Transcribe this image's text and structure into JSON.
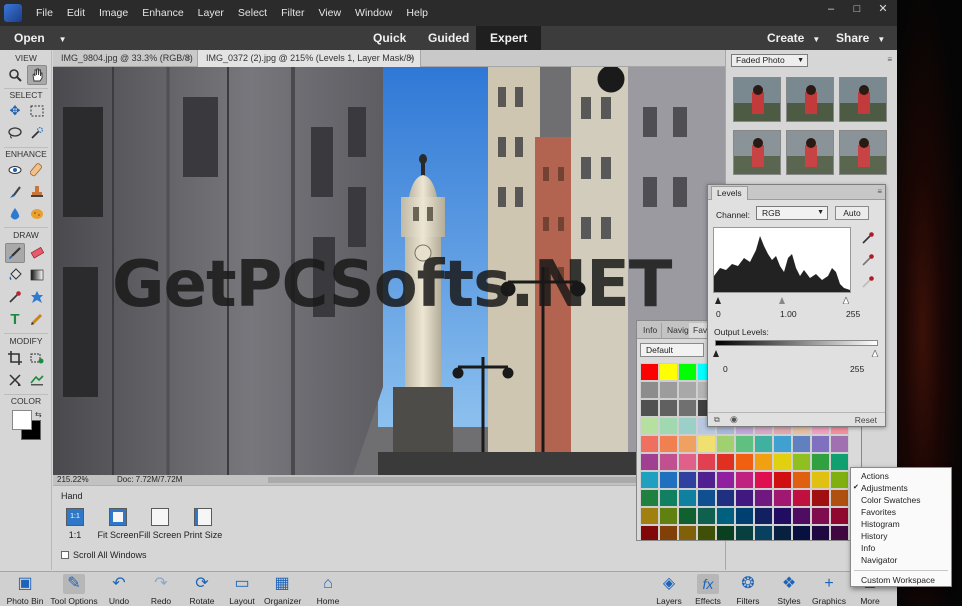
{
  "menubar": {
    "items": [
      "File",
      "Edit",
      "Image",
      "Enhance",
      "Layer",
      "Select",
      "Filter",
      "View",
      "Window",
      "Help"
    ],
    "window_controls": [
      "–",
      "□",
      "✕"
    ]
  },
  "modebar": {
    "open_label": "Open",
    "modes": [
      "Quick",
      "Guided",
      "Expert"
    ],
    "active_mode": "Expert",
    "create_label": "Create",
    "share_label": "Share"
  },
  "toolbox": {
    "sections": [
      "VIEW",
      "SELECT",
      "ENHANCE",
      "DRAW",
      "MODIFY",
      "COLOR"
    ]
  },
  "tabs": [
    {
      "label": "IMG_9804.jpg @ 33.3% (RGB/8)",
      "close": "×"
    },
    {
      "label": "IMG_0372 (2).jpg @ 215% (Levels 1, Layer Mask/8) *",
      "close": "×"
    }
  ],
  "watermark": "GetPCSofts.NET",
  "status": {
    "zoom": "215.22%",
    "doc_size": "Doc: 7.72M/7.72M"
  },
  "tool_options": {
    "tool_name": "Hand",
    "buttons": [
      {
        "icon_text": "1:1",
        "label": "1:1"
      },
      {
        "label": "Fit Screen"
      },
      {
        "label": "Fill Screen"
      },
      {
        "label": "Print Size"
      }
    ],
    "scroll_all_label": "Scroll All Windows"
  },
  "right_panel": {
    "effect_select": "Faded Photo"
  },
  "levels": {
    "tab_label": "Levels",
    "channel_label": "Channel:",
    "channel_value": "RGB",
    "auto_label": "Auto",
    "input_values": [
      "0",
      "1.00",
      "255"
    ],
    "output_label": "Output Levels:",
    "output_values": [
      "0",
      "255"
    ],
    "reset_label": "Reset"
  },
  "swatches": {
    "tabs": [
      "Info",
      "Navig",
      "Favo"
    ],
    "set_value": "Default",
    "colors": [
      "#ff0000",
      "#ffff00",
      "#00ff00",
      "#00ffff",
      "#8e8e8e",
      "#8e8e8e",
      "#8e8e8e",
      "#8e8e8e",
      "#8e8e8e",
      "#8e8e8e",
      "#8e8e8e",
      "#8c8c8c",
      "#9c9c9c",
      "#a8a8a8",
      "#b4b4b4",
      "#8a8a8a",
      "#7a7a7a",
      "#6a6a6a",
      "#5a5a5a",
      "#4a4a4a",
      "#3a3a3a",
      "#2a2a2a",
      "#505050",
      "#606060",
      "#707070",
      "#404040",
      "#353535",
      "#2d2d2d",
      "#252525",
      "#1d1d1d",
      "#151515",
      "#101010",
      "#080808",
      "#b5e0a0",
      "#a0d8b0",
      "#9ad0c8",
      "#b8c8e0",
      "#a8b8d8",
      "#c0a8d8",
      "#d8a8c8",
      "#e0a8b0",
      "#e8c0a0",
      "#f0a0c0",
      "#f090a0",
      "#f07060",
      "#f08050",
      "#f0a060",
      "#f0e070",
      "#a0d070",
      "#60c080",
      "#40b0a0",
      "#40a0d0",
      "#6080c0",
      "#8070c0",
      "#a070b0",
      "#a04090",
      "#c05090",
      "#e0608a",
      "#e04050",
      "#e03020",
      "#f06010",
      "#f0a010",
      "#e0d010",
      "#90c020",
      "#30a040",
      "#10a070",
      "#20a0c0",
      "#2070c0",
      "#3040a0",
      "#502090",
      "#9020a0",
      "#c02080",
      "#e01050",
      "#d01010",
      "#e06010",
      "#e0c010",
      "#80b010",
      "#208040",
      "#108060",
      "#1080a0",
      "#105090",
      "#203080",
      "#401880",
      "#701880",
      "#a01870",
      "#c01040",
      "#a01010",
      "#b05010",
      "#a08010",
      "#608010",
      "#106030",
      "#106050",
      "#006080",
      "#004070",
      "#102060",
      "#200c60",
      "#500c60",
      "#800c50",
      "#900830",
      "#800808",
      "#804008",
      "#806008",
      "#405008",
      "#084020",
      "#084040",
      "#084060",
      "#082040",
      "#081040",
      "#200840",
      "#400840"
    ]
  },
  "panel_menu": {
    "items": [
      "Actions",
      "Adjustments",
      "Color Swatches",
      "Favorites",
      "Histogram",
      "History",
      "Info",
      "Navigator",
      "Custom Workspace"
    ],
    "checked": "Adjustments",
    "check_mark": "✔"
  },
  "taskbar": {
    "left": [
      "Photo Bin",
      "Tool Options",
      "Undo",
      "Redo",
      "Rotate",
      "Layout",
      "Organizer",
      "Home Screen"
    ],
    "right": [
      "Layers",
      "Effects",
      "Filters",
      "Styles",
      "Graphics",
      "More"
    ]
  },
  "icons": {
    "zoom": "zoom-icon",
    "hand": "hand-icon",
    "move": "move-icon",
    "marquee": "marquee-icon",
    "lasso": "lasso-icon",
    "quick_select": "quick-selection-icon",
    "eye": "red-eye-icon",
    "spot_heal": "spot-healing-icon",
    "smart_brush": "smart-brush-icon",
    "clone": "clone-stamp-icon",
    "blur": "blur-icon",
    "sponge": "sponge-icon",
    "brush": "brush-icon",
    "eraser": "eraser-icon",
    "bucket": "paint-bucket-icon",
    "gradient": "gradient-icon",
    "eyedropper": "eyedropper-icon",
    "custom_shape": "custom-shape-icon",
    "type": "type-icon",
    "pencil": "pencil-icon",
    "crop": "crop-icon",
    "recompose": "recompose-icon",
    "content_move": "content-aware-move-icon",
    "straighten": "straighten-icon"
  },
  "colors": {
    "menubar_bg": "#2b2b2b",
    "modebar_bg": "#3c3c3c",
    "active_mode_bg": "#1f1f1f",
    "accent_blue": "#1d64b8",
    "sky_blue": "#4a8fd8"
  }
}
